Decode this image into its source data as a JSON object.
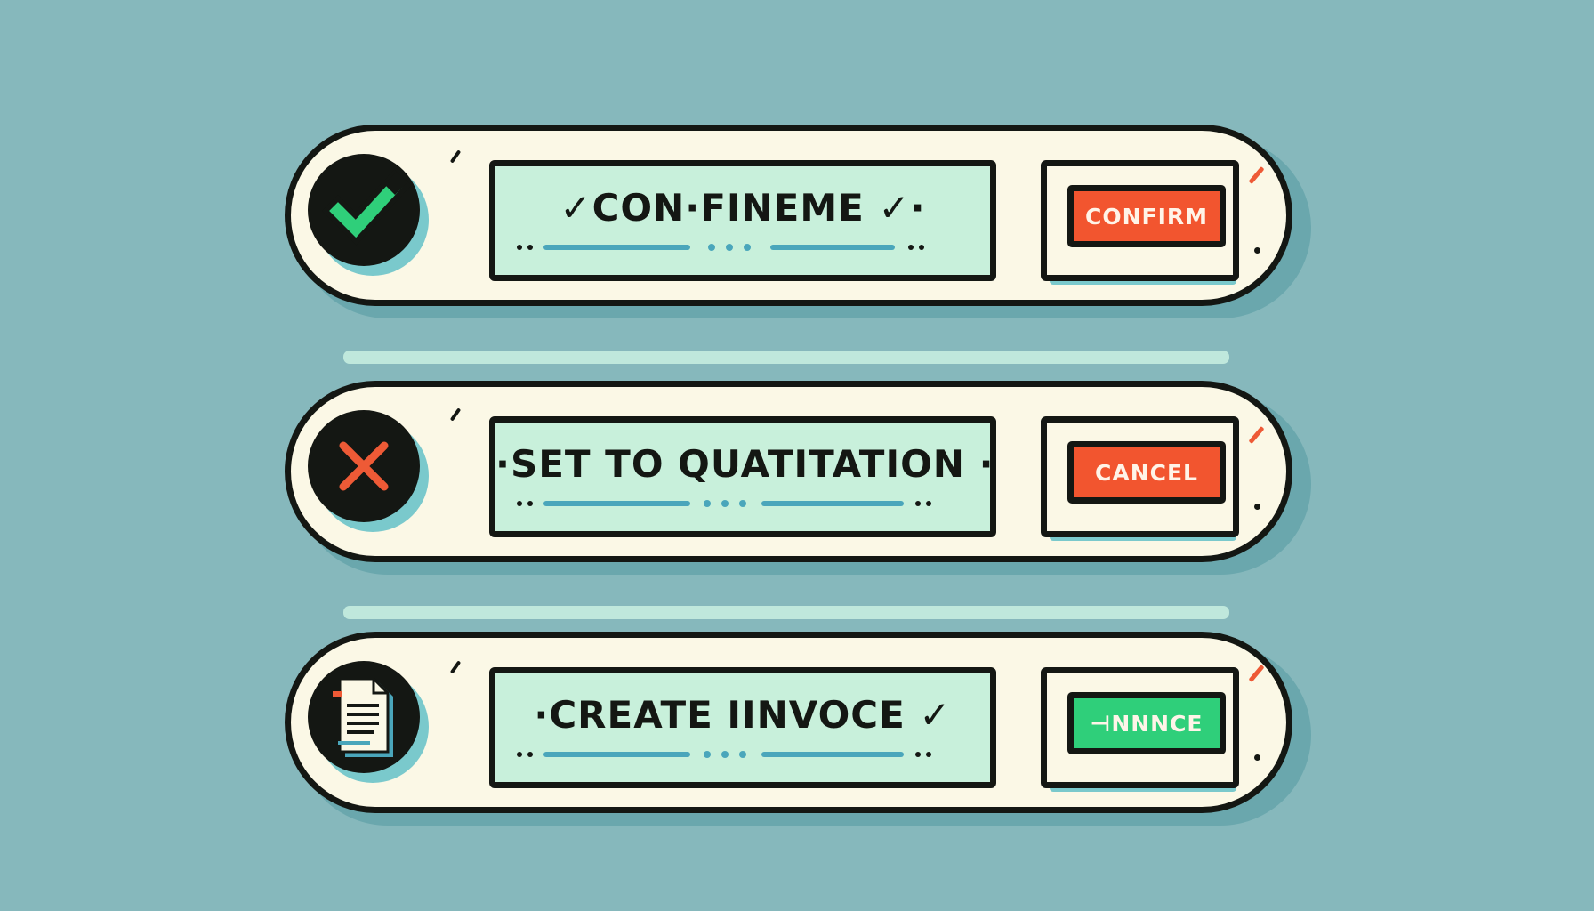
{
  "colors": {
    "background": "#86b8bc",
    "pill": "#fbf8e6",
    "outline": "#141713",
    "field": "#c8f0db",
    "accent_blue": "#4aa6bb",
    "red": "#ee5a36",
    "green": "#2fcf7a"
  },
  "rows": [
    {
      "icon": "check-icon",
      "field_label": "✓CON·FINEME ✓·",
      "button_label": "CONFIRM",
      "button_color": "#f2552f"
    },
    {
      "icon": "cross-icon",
      "field_label": "·SET TO QUATITATION ·",
      "button_label": "CANCEL",
      "button_color": "#f2552f"
    },
    {
      "icon": "document-icon",
      "field_label": "·CREATE IINVOCE ✓",
      "button_label": "⊣NNNCE",
      "button_color": "#2fcf7a"
    }
  ]
}
